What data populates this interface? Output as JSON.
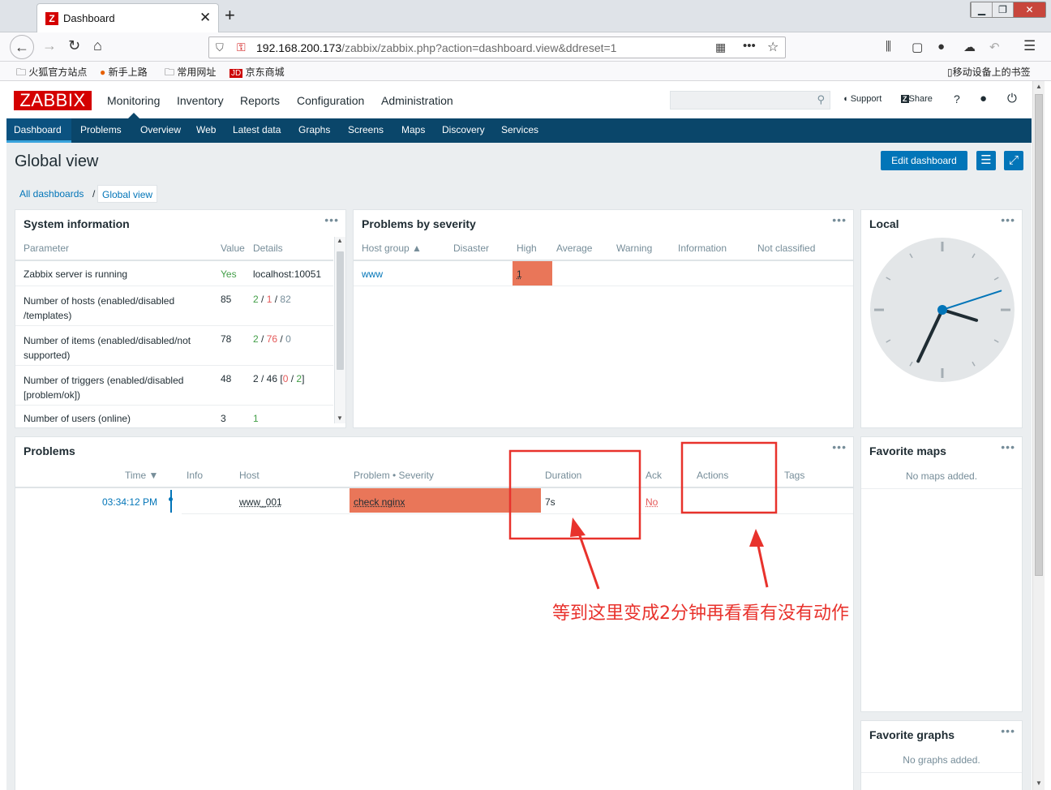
{
  "browser": {
    "tab_title": "Dashboard",
    "new_tab": "+",
    "url_host": "192.168.200.173",
    "url_path": "/zabbix/zabbix.php?action=dashboard.view&ddreset=1",
    "bookmarks": [
      "火狐官方站点",
      "新手上路",
      "常用网址",
      "京东商城"
    ],
    "mobile_bookmarks": "移动设备上的书签"
  },
  "zabbix": {
    "logo": "ZABBIX",
    "top_menu": [
      "Monitoring",
      "Inventory",
      "Reports",
      "Configuration",
      "Administration"
    ],
    "support": "Support",
    "share": "Share",
    "help": "?",
    "sub_menu": [
      "Dashboard",
      "Problems",
      "Overview",
      "Web",
      "Latest data",
      "Graphs",
      "Screens",
      "Maps",
      "Discovery",
      "Services"
    ],
    "page_title": "Global view",
    "edit_dashboard": "Edit dashboard",
    "breadcrumb": {
      "all": "All dashboards",
      "sep": "/",
      "current": "Global view"
    }
  },
  "system_info": {
    "title": "System information",
    "headers": [
      "Parameter",
      "Value",
      "Details"
    ],
    "rows": [
      {
        "param": "Zabbix server is running",
        "value": "Yes",
        "details": "localhost:10051"
      },
      {
        "param": "Number of hosts (enabled/disabled /templates)",
        "value": "85",
        "d1": "2",
        "d2": "1",
        "d3": "82"
      },
      {
        "param": "Number of items (enabled/disabled/not supported)",
        "value": "78",
        "d1": "2",
        "d2": "76",
        "d3": "0"
      },
      {
        "param": "Number of triggers (enabled/disabled [problem/ok])",
        "value": "48",
        "d1": "2 / 46 [",
        "d2": "0",
        "d3": "2",
        "d4": "]"
      },
      {
        "param": "Number of users (online)",
        "value": "3",
        "details": "1"
      }
    ]
  },
  "problems_by_severity": {
    "title": "Problems by severity",
    "headers": [
      "Host group ▲",
      "Disaster",
      "High",
      "Average",
      "Warning",
      "Information",
      "Not classified"
    ],
    "row": {
      "group": "www",
      "high": "1"
    }
  },
  "clock": {
    "title": "Local",
    "hour": 3,
    "minute": 34,
    "second": 12
  },
  "problems": {
    "title": "Problems",
    "headers": [
      "Time ▼",
      "Info",
      "Host",
      "Problem • Severity",
      "Duration",
      "Ack",
      "Actions",
      "Tags"
    ],
    "row": {
      "time": "03:34:12 PM",
      "host": "www_001",
      "problem": "check nginx",
      "duration": "7s",
      "ack": "No"
    }
  },
  "favorite_maps": {
    "title": "Favorite maps",
    "empty": "No maps added."
  },
  "favorite_graphs": {
    "title": "Favorite graphs",
    "empty": "No graphs added."
  },
  "annotation": {
    "text": "等到这里变成2分钟再看看有没有动作",
    "color": "#e8322c"
  },
  "colors": {
    "high": "#e97659",
    "nav": "#0a466a",
    "brand": "#d40000",
    "link": "#0275b8"
  }
}
